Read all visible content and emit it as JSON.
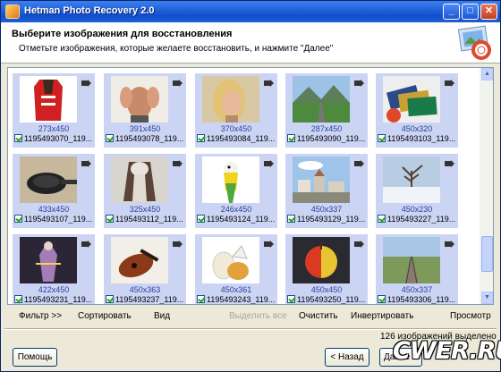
{
  "window": {
    "title": "Hetman Photo Recovery 2.0",
    "controls": [
      "minimize",
      "maximize",
      "close"
    ]
  },
  "header": {
    "title": "Выберите изображения для восстановления",
    "subtitle": "Отметьте изображения, которые желаете восстановить, и нажмите \"Далее\""
  },
  "gallery": {
    "items": [
      {
        "dims": "273x450",
        "name": "1195493070_119...",
        "checked": true,
        "thumb": "red-jersey"
      },
      {
        "dims": "391x450",
        "name": "1195493078_119...",
        "checked": true,
        "thumb": "head-hands"
      },
      {
        "dims": "370x450",
        "name": "1195493084_119...",
        "checked": true,
        "thumb": "blonde-woman"
      },
      {
        "dims": "287x450",
        "name": "1195493090_119...",
        "checked": true,
        "thumb": "mountain-road"
      },
      {
        "dims": "450x320",
        "name": "1195493103_119...",
        "checked": true,
        "thumb": "credit-cards"
      },
      {
        "dims": "433x450",
        "name": "1195493107_119...",
        "checked": true,
        "thumb": "frying-pan"
      },
      {
        "dims": "325x450",
        "name": "1195493112_119...",
        "checked": true,
        "thumb": "fur-coat"
      },
      {
        "dims": "246x450",
        "name": "1195493124_119...",
        "checked": true,
        "thumb": "parrot"
      },
      {
        "dims": "450x337",
        "name": "1195493129_119...",
        "checked": true,
        "thumb": "town-sky"
      },
      {
        "dims": "450x230",
        "name": "1195493227_119...",
        "checked": true,
        "thumb": "winter-tree"
      },
      {
        "dims": "422x450",
        "name": "1195493231_119...",
        "checked": true,
        "thumb": "dark-figure"
      },
      {
        "dims": "450x363",
        "name": "1195493237_119...",
        "checked": true,
        "thumb": "violin"
      },
      {
        "dims": "450x361",
        "name": "1195493243_119...",
        "checked": true,
        "thumb": "eggs"
      },
      {
        "dims": "450x450",
        "name": "1195493250_119...",
        "checked": true,
        "thumb": "apple"
      },
      {
        "dims": "450x337",
        "name": "1195493306_119...",
        "checked": true,
        "thumb": "railroad"
      }
    ]
  },
  "toolbar": {
    "filter": "Фильтр >>",
    "sort": "Сортировать",
    "view": "Вид",
    "select_all": "Выделить все",
    "clear": "Очистить",
    "invert": "Инвертировать",
    "preview": "Просмотр"
  },
  "status": {
    "text": "126 изображений выделено"
  },
  "buttons": {
    "help": "Помощь",
    "back": "< Назад",
    "next": "Далее >"
  },
  "watermark": "CWER.RU",
  "colors": {
    "titlebar": "#0f4fce",
    "tile_bg": "#ccd4f4",
    "dims_text": "#2a3f9a"
  }
}
